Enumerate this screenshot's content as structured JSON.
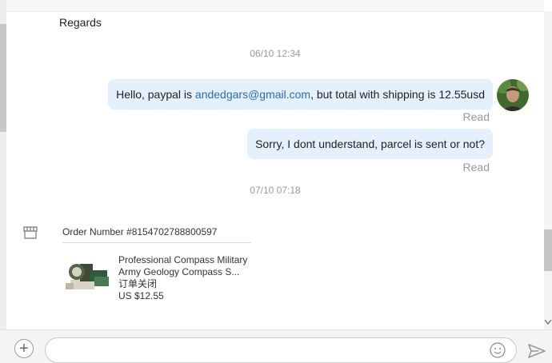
{
  "thread": {
    "greeting_tail": "Regards",
    "timestamp_1": "06/10 12:34",
    "timestamp_2": "07/10 07:18",
    "messages": [
      {
        "text_before": "Hello, paypal is ",
        "link": "andedgars@gmail.com",
        "text_after": ", but total with shipping is 12.55usd",
        "status": "Read"
      },
      {
        "text": "Sorry, I dont understand, parcel is sent or not?",
        "status": "Read"
      }
    ]
  },
  "order": {
    "number_label": "Order Number #8154702788800597",
    "product_title": "Professional Compass Military Army Geology Compass S...",
    "status": "订单关闭",
    "price": "US $12.55"
  },
  "composer": {
    "placeholder": "",
    "add_icon": "plus-icon",
    "emoji_icon": "smiley-icon",
    "send_icon": "send-icon"
  },
  "colors": {
    "bubble": "#e4f0fc",
    "link": "#2a6cbf",
    "muted": "#9a9a9a"
  }
}
